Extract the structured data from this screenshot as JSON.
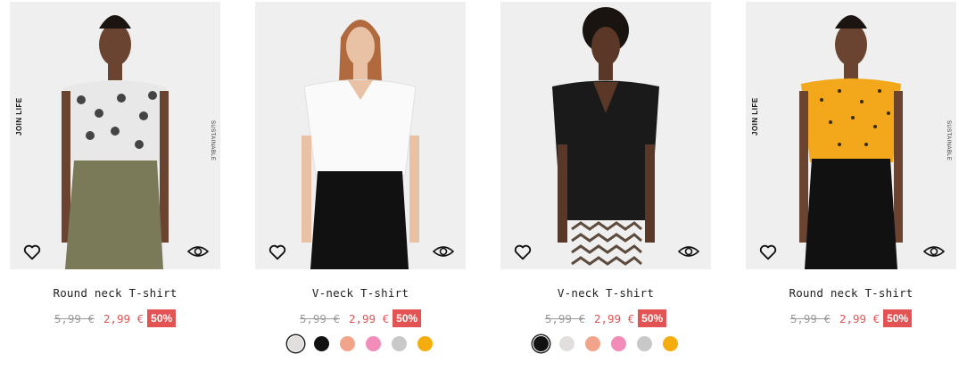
{
  "products": [
    {
      "name": "Round neck T-shirt",
      "old_price": "5,99 €",
      "new_price": "2,99 €",
      "discount": "50%",
      "badge_left": "JOIN LIFE",
      "badge_right": "SUSTAINABLE",
      "colors": []
    },
    {
      "name": "V-neck T-shirt",
      "old_price": "5,99 €",
      "new_price": "2,99 €",
      "discount": "50%",
      "badge_left": "",
      "badge_right": "",
      "selected_color": 0,
      "colors": [
        "#e2dede",
        "#111111",
        "#f2a48b",
        "#f28cb9",
        "#c8c8c8",
        "#f4ad0c"
      ]
    },
    {
      "name": "V-neck T-shirt",
      "old_price": "5,99 €",
      "new_price": "2,99 €",
      "discount": "50%",
      "badge_left": "",
      "badge_right": "",
      "selected_color": 0,
      "colors": [
        "#111111",
        "#e2dede",
        "#f2a48b",
        "#f28cb9",
        "#c8c8c8",
        "#f4ad0c"
      ]
    },
    {
      "name": "Round neck T-shirt",
      "old_price": "5,99 €",
      "new_price": "2,99 €",
      "discount": "50%",
      "badge_left": "JOIN LIFE",
      "badge_right": "SUSTAINABLE",
      "colors": []
    }
  ]
}
